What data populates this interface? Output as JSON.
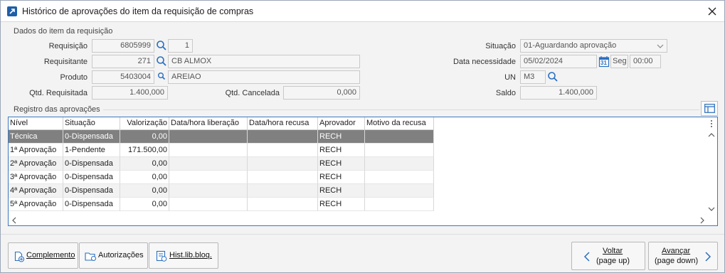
{
  "window": {
    "title": "Histórico de aprovações do item da requisição de compras"
  },
  "item_section": {
    "title": "Dados do item da requisição",
    "requisicao_label": "Requisição",
    "requisicao_value": "6805999",
    "requisicao_seq": "1",
    "requisitante_label": "Requisitante",
    "requisitante_code": "271",
    "requisitante_name": "CB ALMOX",
    "produto_label": "Produto",
    "produto_code": "5403004",
    "produto_name": "AREIAO",
    "qtd_requisitada_label": "Qtd. Requisitada",
    "qtd_requisitada_value": "1.400,000",
    "qtd_cancelada_label": "Qtd. Cancelada",
    "qtd_cancelada_value": "0,000",
    "situacao_label": "Situação",
    "situacao_value": "01-Aguardando aprovação",
    "data_necessidade_label": "Data necessidade",
    "data_necessidade_value": "05/02/2024",
    "calendar_day": "31",
    "weekday": "Seg",
    "time": "00:00",
    "un_label": "UN",
    "un_value": "M3",
    "saldo_label": "Saldo",
    "saldo_value": "1.400,000"
  },
  "approvals": {
    "title": "Registro das aprovações",
    "columns": [
      "Nível",
      "Situação",
      "Valorização",
      "Data/hora liberação",
      "Data/hora recusa",
      "Aprovador",
      "Motivo da recusa"
    ],
    "rows": [
      {
        "nivel": "Técnica",
        "situacao": "0-Dispensada",
        "valorizacao": "0,00",
        "liberacao": "",
        "recusa": "",
        "aprovador": "RECH",
        "motivo": ""
      },
      {
        "nivel": "1ª Aprovação",
        "situacao": "1-Pendente",
        "valorizacao": "171.500,00",
        "liberacao": "",
        "recusa": "",
        "aprovador": "RECH",
        "motivo": ""
      },
      {
        "nivel": "2ª Aprovação",
        "situacao": "0-Dispensada",
        "valorizacao": "0,00",
        "liberacao": "",
        "recusa": "",
        "aprovador": "RECH",
        "motivo": ""
      },
      {
        "nivel": "3ª Aprovação",
        "situacao": "0-Dispensada",
        "valorizacao": "0,00",
        "liberacao": "",
        "recusa": "",
        "aprovador": "RECH",
        "motivo": ""
      },
      {
        "nivel": "4ª Aprovação",
        "situacao": "0-Dispensada",
        "valorizacao": "0,00",
        "liberacao": "",
        "recusa": "",
        "aprovador": "RECH",
        "motivo": ""
      },
      {
        "nivel": "5ª Aprovação",
        "situacao": "0-Dispensada",
        "valorizacao": "0,00",
        "liberacao": "",
        "recusa": "",
        "aprovador": "RECH",
        "motivo": ""
      }
    ]
  },
  "footer": {
    "complemento": "Complemento",
    "autorizacoes": "Autorizações",
    "hist_lib_bloq": "Hist.lib.bloq.",
    "voltar": "Voltar",
    "voltar_hint": "(page up)",
    "avancar": "Avançar",
    "avancar_hint": "(page down)"
  }
}
